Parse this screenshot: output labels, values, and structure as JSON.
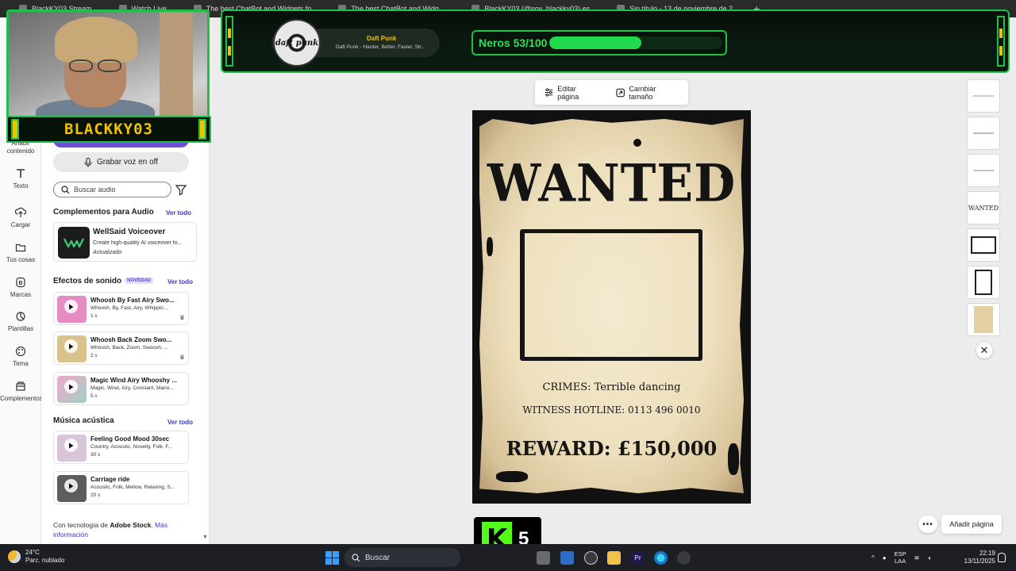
{
  "browser": {
    "tabs": [
      "BlackKY03 Stream",
      "Watch Live",
      "The best ChatBot and Widgets fo",
      "The best ChatBot and Widg...",
      "BlackKY03 (@soy_blackky03) es",
      "Sin título - 13 de noviembre de 2"
    ]
  },
  "rail": {
    "items": [
      {
        "label": "Añadir contenido",
        "icon": "plus-icon"
      },
      {
        "label": "Texto",
        "icon": "text-icon"
      },
      {
        "label": "Cargar",
        "icon": "upload-icon"
      },
      {
        "label": "Tus cosas",
        "icon": "folder-icon"
      },
      {
        "label": "Marcas",
        "icon": "brand-icon"
      },
      {
        "label": "Plantillas",
        "icon": "templates-icon"
      },
      {
        "label": "Tema",
        "icon": "palette-icon"
      },
      {
        "label": "Complementos",
        "icon": "addons-icon"
      }
    ]
  },
  "panel": {
    "record_label": "Grabar voz en off",
    "search_placeholder": "Buscar audio",
    "addons_title": "Complementos para Audio",
    "see_all": "Ver todo",
    "wellsaid": {
      "title": "WellSaid Voiceover",
      "desc": "Create high-quality AI voiceover fo...",
      "status": "Actualizado"
    },
    "sfx_title": "Efectos de sonido",
    "new_badge": "NOVEDAD",
    "sfx": [
      {
        "title": "Whoosh By Fast Airy Swo...",
        "tags": "Whoosh, By, Fast, Airy, Whippin...",
        "dur": "1 s",
        "color": "#e58cc4"
      },
      {
        "title": "Whoosh Back Zoom Swo...",
        "tags": "Whoosh, Back, Zoom, Swoosh, ...",
        "dur": "2 s",
        "color": "#d9c38c"
      },
      {
        "title": "Magic Wind Airy Whooshy ...",
        "tags": "Magic, Wind, Airy, Constant, Mano...",
        "dur": "5 s",
        "color": "#e9a6c0"
      }
    ],
    "music_title": "Música acústica",
    "music": [
      {
        "title": "Feeling Good Mood 30sec",
        "tags": "Country, Acoustic, Novelty, Folk, F...",
        "dur": "30 s",
        "color": "#d8c6d8"
      },
      {
        "title": "Carriage ride",
        "tags": "Acoustic, Folk, Mellow, Relaxing, S...",
        "dur": "20 s",
        "color": "#5d5d5d"
      }
    ],
    "powered_prefix": "Con tecnología de ",
    "powered_brand": "Adobe Stock",
    "powered_link": "Más información"
  },
  "overlay": {
    "streamer": "BLACKKY03",
    "album_text": "daft punk",
    "artist": "Daft Punk",
    "track": "Daft Punk - Harder, Better, Faster, Str...",
    "goal_label": "Neros 53/100",
    "goal_current": 53,
    "goal_total": 100
  },
  "toolbar": {
    "edit_label": "Editar página",
    "resize_label": "Cambiar tamaño"
  },
  "poster": {
    "heading": "WANTED",
    "crimes": "CRIMES: Terrible dancing",
    "hotline": "WITNESS HOTLINE: 0113 496 0010",
    "reward": "REWARD: £150,000"
  },
  "thumbs": {
    "wanted_text": "WANTED"
  },
  "bottom": {
    "add_page": "Añadir página",
    "kick_letter": "K",
    "kick_count": "5"
  },
  "taskbar": {
    "temp": "24°C",
    "weather": "Parc. nublado",
    "search": "Buscar",
    "lang_1": "ESP",
    "lang_2": "LAA",
    "time": "22:19",
    "date": "13/11/2025"
  }
}
